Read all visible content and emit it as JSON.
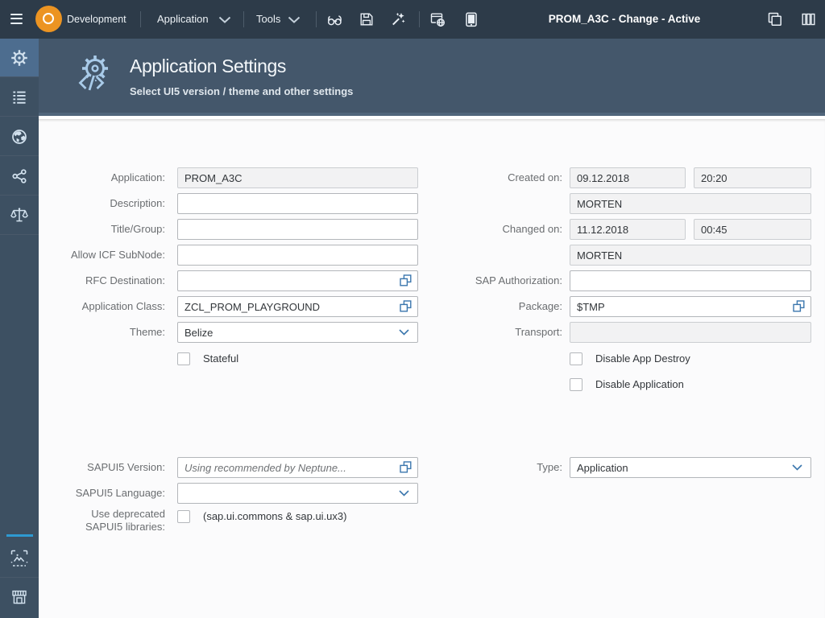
{
  "topbar": {
    "product_label": "Development",
    "menu_application": "Application",
    "menu_tools": "Tools",
    "window_title": "PROM_A3C - Change - Active"
  },
  "page_header": {
    "title": "Application Settings",
    "subtitle": "Select UI5 version / theme and other settings"
  },
  "form": {
    "application": {
      "label": "Application:",
      "value": "PROM_A3C"
    },
    "description": {
      "label": "Description:",
      "value": ""
    },
    "title_group": {
      "label": "Title/Group:",
      "value": ""
    },
    "allow_icf_subnode": {
      "label": "Allow ICF SubNode:",
      "value": ""
    },
    "rfc_destination": {
      "label": "RFC Destination:",
      "value": ""
    },
    "application_class": {
      "label": "Application Class:",
      "value": "ZCL_PROM_PLAYGROUND"
    },
    "theme": {
      "label": "Theme:",
      "value": "Belize"
    },
    "stateful": {
      "label": "Stateful",
      "checked": false
    },
    "created_on": {
      "label": "Created on:",
      "date": "09.12.2018",
      "time": "20:20",
      "user": "MORTEN"
    },
    "changed_on": {
      "label": "Changed on:",
      "date": "11.12.2018",
      "time": "00:45",
      "user": "MORTEN"
    },
    "sap_authorization": {
      "label": "SAP Authorization:",
      "value": ""
    },
    "package": {
      "label": "Package:",
      "value": "$TMP"
    },
    "transport": {
      "label": "Transport:",
      "value": ""
    },
    "disable_app_destroy": {
      "label": "Disable App Destroy",
      "checked": false
    },
    "disable_application": {
      "label": "Disable Application",
      "checked": false
    },
    "sapui5_version": {
      "label": "SAPUI5 Version:",
      "value": "",
      "placeholder": "Using recommended by Neptune..."
    },
    "sapui5_language": {
      "label": "SAPUI5 Language:",
      "value": ""
    },
    "deprecated_libs": {
      "label": "Use deprecated SAPUI5 libraries:",
      "hint": "(sap.ui.commons & sap.ui.ux3)",
      "checked": false
    },
    "type": {
      "label": "Type:",
      "value": "Application"
    }
  },
  "colors": {
    "topbar_bg": "#2d3b49",
    "header_bg": "#44576b",
    "sidebar_bg": "#3d5062",
    "sidebar_active": "#4d6d8f",
    "accent_orange": "#ec9422",
    "icon_blue": "#3a76ad",
    "indicator_blue": "#2e9ad2"
  }
}
